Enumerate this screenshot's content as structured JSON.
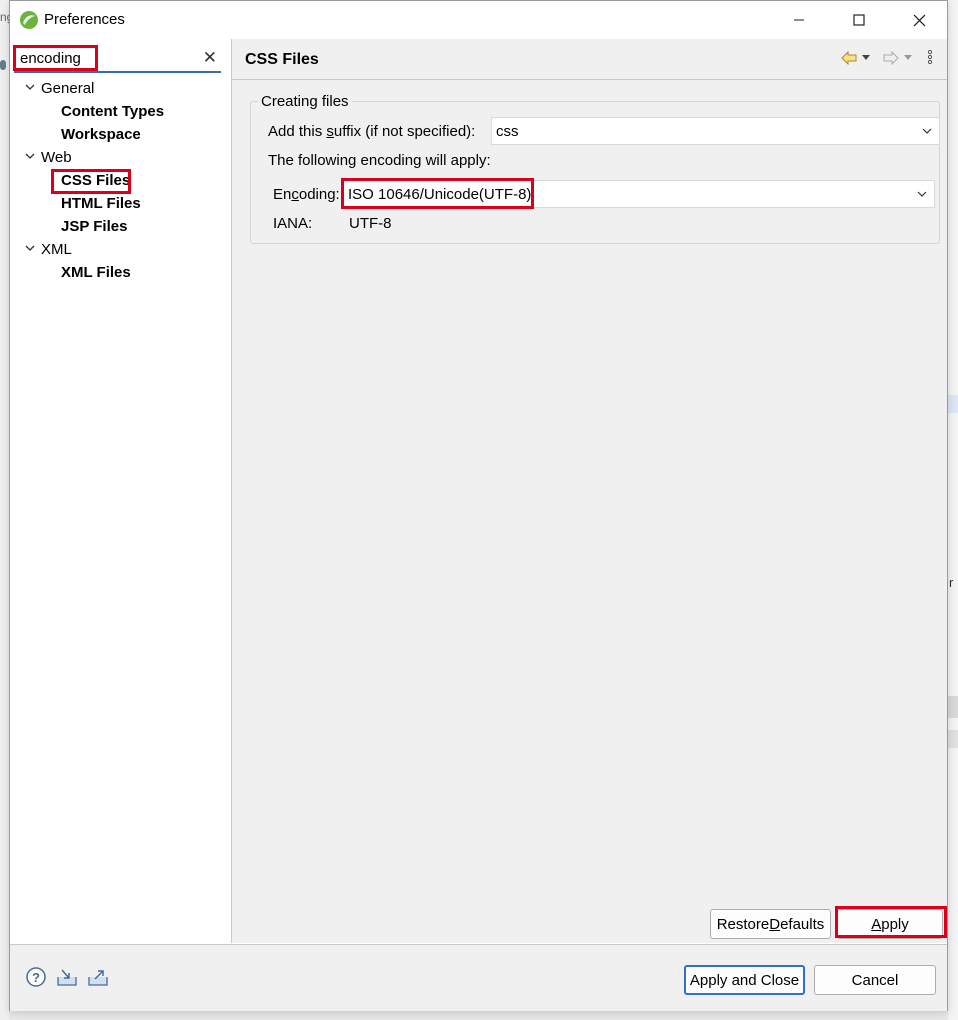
{
  "window": {
    "title": "Preferences"
  },
  "search": {
    "value": "encoding"
  },
  "tree": {
    "items": [
      {
        "label": "General",
        "kind": "category"
      },
      {
        "label": "Content Types",
        "kind": "leaf"
      },
      {
        "label": "Workspace",
        "kind": "leaf"
      },
      {
        "label": "Web",
        "kind": "category"
      },
      {
        "label": "CSS Files",
        "kind": "leaf"
      },
      {
        "label": "HTML Files",
        "kind": "leaf"
      },
      {
        "label": "JSP Files",
        "kind": "leaf"
      },
      {
        "label": "XML",
        "kind": "category"
      },
      {
        "label": "XML Files",
        "kind": "leaf"
      }
    ]
  },
  "page": {
    "title": "CSS Files",
    "group_label": "Creating files",
    "suffix_label_pre": "Add this ",
    "suffix_label_mnemonic": "s",
    "suffix_label_post": "uffix (if not specified):",
    "suffix_value": "css",
    "encoding_note": "The following encoding will apply:",
    "encoding_label_pre": "En",
    "encoding_label_mnemonic": "c",
    "encoding_label_post": "oding:",
    "encoding_value": "ISO 10646/Unicode(UTF-8)",
    "iana_label": "IANA:",
    "iana_value": "UTF-8"
  },
  "buttons": {
    "restore_pre": "Restore ",
    "restore_mnemonic": "D",
    "restore_post": "efaults",
    "apply_mnemonic": "A",
    "apply_post": "pply",
    "apply_close": "Apply and Close",
    "cancel": "Cancel"
  },
  "colors": {
    "highlight": "#d8001c",
    "focus": "#2f6fd0",
    "accent": "#3b6ea5"
  },
  "editor_bg": {
    "left_glyph": "ng",
    "right_glyph": "r"
  }
}
